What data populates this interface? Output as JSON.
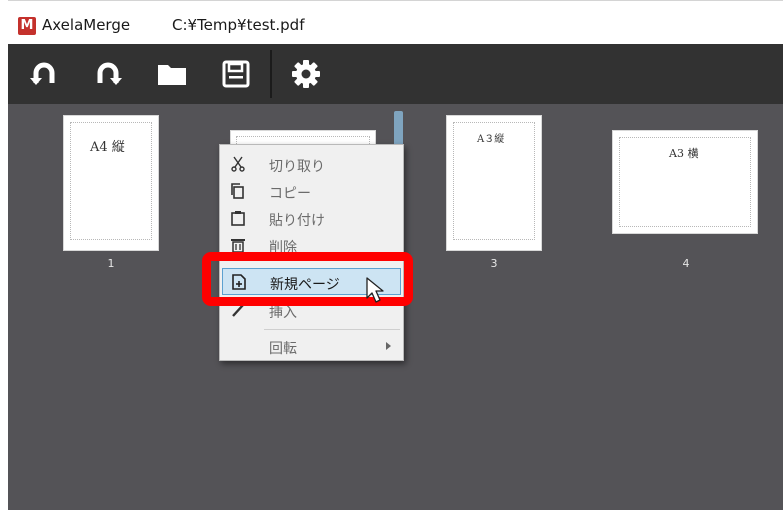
{
  "titlebar": {
    "app_logo": "M",
    "app_name": "AxelaMerge",
    "file_path": "C:¥Temp¥test.pdf"
  },
  "toolbar": {
    "buttons": [
      {
        "icon": "rotate-left-icon"
      },
      {
        "icon": "rotate-right-icon"
      },
      {
        "icon": "folder-icon"
      },
      {
        "icon": "save-icon"
      },
      {
        "icon": "gear-icon"
      }
    ]
  },
  "pages": [
    {
      "label": "A4 縦",
      "number": "1"
    },
    {
      "label": "",
      "number": ""
    },
    {
      "label": "A３縦",
      "number": "3"
    },
    {
      "label": "A3 横",
      "number": "4"
    }
  ],
  "context_menu": {
    "items": [
      {
        "label": "切り取り",
        "icon": "cut-icon",
        "state": "disabled"
      },
      {
        "label": "コピー",
        "icon": "copy-icon",
        "state": "disabled"
      },
      {
        "label": "貼り付け",
        "icon": "paste-icon",
        "state": "disabled"
      },
      {
        "label": "削除",
        "icon": "delete-icon",
        "state": "disabled"
      },
      {
        "label": "新規ページ",
        "icon": "new-page-icon",
        "state": "highlighted"
      },
      {
        "label": "挿入",
        "icon": "pen-icon",
        "state": "disabled"
      },
      {
        "label": "回転",
        "icon": "",
        "state": "disabled",
        "has_submenu": true
      }
    ]
  },
  "colors": {
    "toolbar_bg": "#323232",
    "workspace_bg": "#545357",
    "highlight_bg": "#cde4f3",
    "highlight_border": "#5da1d0",
    "annotation": "#ff0000",
    "logo_bg": "#c4312c"
  }
}
